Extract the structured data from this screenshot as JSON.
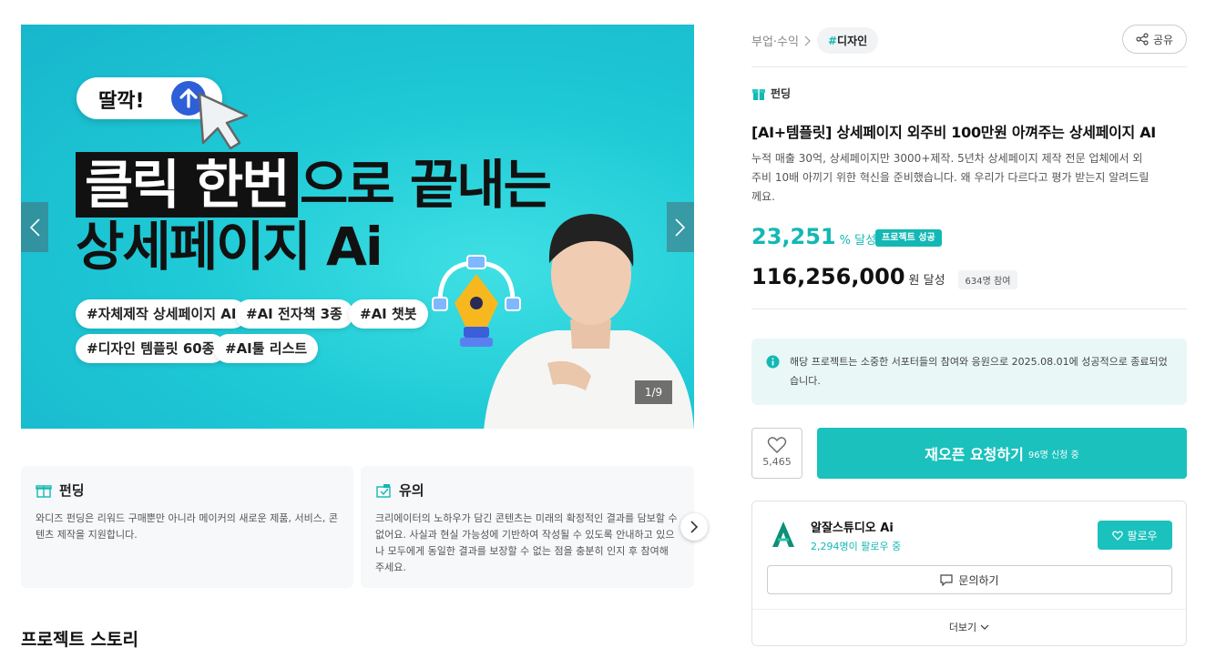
{
  "hero": {
    "click_label": "딸깍!",
    "highlight": "클릭 한번",
    "headline_rest": "으로 끝내는",
    "headline_line2": "상세페이지 Ai",
    "tags": [
      "#자체제작 상세페이지 AI",
      "#AI 전자책 3종",
      "#AI 챗봇",
      "#디자인 템플릿 60종",
      "#AI툴 리스트"
    ],
    "counter": "1/9"
  },
  "info_cards": [
    {
      "title": "펀딩",
      "icon": "gift-icon",
      "desc": "와디즈 펀딩은 리워드 구매뿐만 아니라 메이커의 새로운 제품, 서비스, 콘텐츠 제작을 지원합니다."
    },
    {
      "title": "유의",
      "icon": "box-icon",
      "desc": "크리에이터의 노하우가 담긴 콘텐츠는 미래의 확정적인 결과를 담보할 수 없어요. 사실과 현실 가능성에 기반하여 작성될 수 있도록 안내하고 있으나 모두에게 동일한 결과를 보장할 수 없는 점을 충분히 인지 후 참여해 주세요."
    }
  ],
  "story_title": "프로젝트 스토리",
  "breadcrumb": {
    "category": "부업·수익",
    "tag_hash": "#",
    "tag_label": "디자인"
  },
  "share_label": "공유",
  "funding_label": "펀딩",
  "project": {
    "title": "[AI+템플릿] 상세페이지 외주비 100만원 아껴주는 상세페이지 AI",
    "description": "누적 매출 30억, 상세페이지만 3000+제작. 5년차 상세페이지 제작 전문 업체에서 외주비 10배 아끼기 위한 혁신을 준비했습니다. 왜 우리가 다르다고 평가 받는지 알려드릴께요.",
    "rate": "23,251",
    "rate_unit": "% 달성",
    "success_badge": "프로젝트 성공",
    "amount": "116,256,000",
    "amount_unit": "원 달성",
    "participants": "634명 참여"
  },
  "notice": "해당 프로젝트는 소중한 서포터들의 참여와 응원으로 2025.08.01에 성공적으로 종료되었습니다.",
  "like_count": "5,465",
  "reopen": {
    "label": "재오픈 요청하기",
    "sub": "96명 신청 중"
  },
  "maker": {
    "name": "알잘스튜디오 Ai",
    "followers": "2,294명이 팔로우 중",
    "follow_label": "팔로우",
    "inquiry_label": "문의하기",
    "more_label": "더보기"
  },
  "colors": {
    "accent": "#1bc1bd",
    "accent_text": "#13b8b4",
    "hero_bg": "#1fcad6"
  }
}
